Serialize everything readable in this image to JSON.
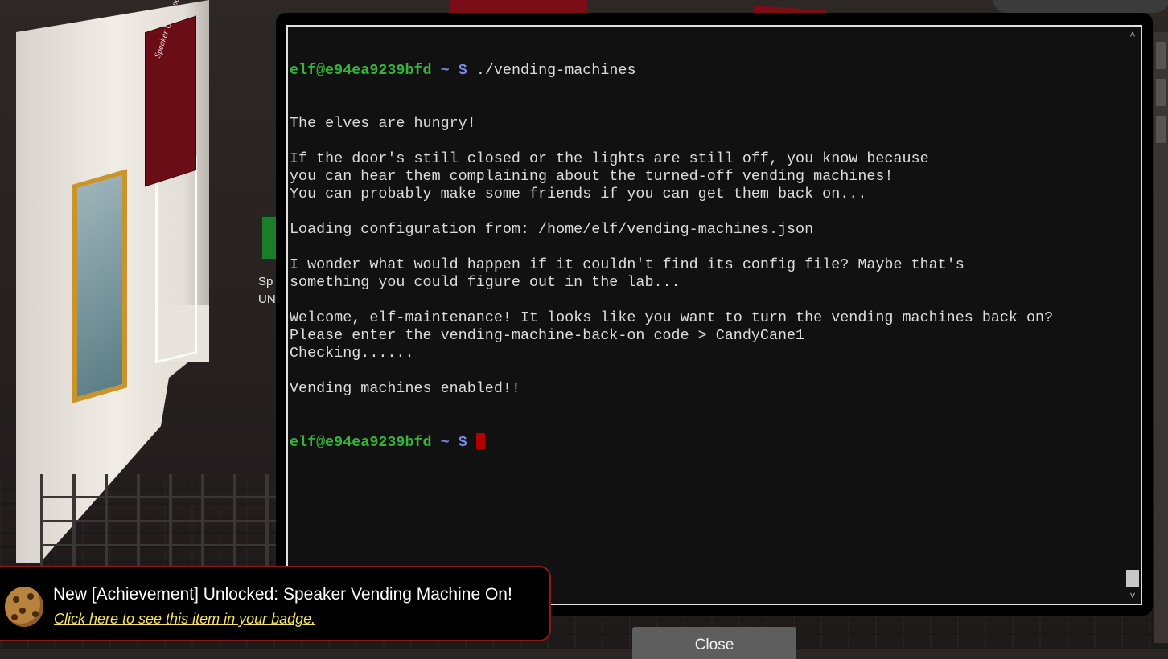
{
  "background": {
    "side_label": "Sp\nUN",
    "sign_text": "Speaker UNpreparedness Room"
  },
  "terminal": {
    "user_host": "elf@e94ea9239bfd",
    "tilde": "~",
    "dollar": "$",
    "command": "./vending-machines",
    "output_lines": [
      "The elves are hungry!",
      "",
      "If the door's still closed or the lights are still off, you know because",
      "you can hear them complaining about the turned-off vending machines!",
      "You can probably make some friends if you can get them back on...",
      "",
      "Loading configuration from: /home/elf/vending-machines.json",
      "",
      "I wonder what would happen if it couldn't find its config file? Maybe that's",
      "something you could figure out in the lab...",
      "",
      "Welcome, elf-maintenance! It looks like you want to turn the vending machines back on?",
      "Please enter the vending-machine-back-on code > CandyCane1",
      "Checking......",
      "",
      "Vending machines enabled!!"
    ],
    "colors": {
      "user_host": "#34b539",
      "tilde": "#7d8ce0",
      "cursor": "#b00000",
      "text": "#dcdcdc",
      "background": "#111111"
    }
  },
  "close_button": {
    "label": "Close"
  },
  "toast": {
    "icon": "cookie-icon",
    "title": "New [Achievement] Unlocked: Speaker Vending Machine On!",
    "link": "Click here to see this item in your badge.",
    "colors": {
      "border": "#8b1a1a",
      "link": "#f5e35c"
    }
  }
}
